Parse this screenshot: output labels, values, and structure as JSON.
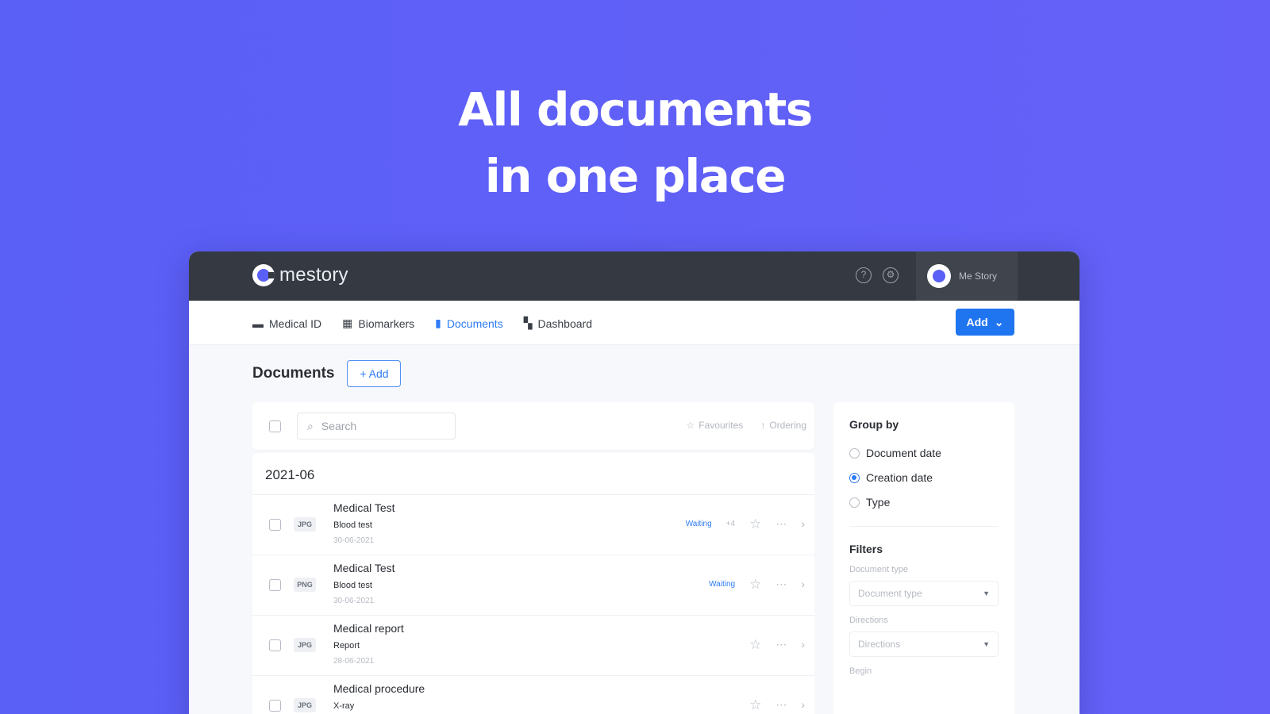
{
  "hero": {
    "line1": "All documents",
    "line2": "in one place"
  },
  "app": {
    "brand": "mestory",
    "profile_name": "Me Story",
    "icons": {
      "help": "question-circle-icon",
      "settings": "gear-icon"
    }
  },
  "nav": {
    "items": [
      {
        "label": "Medical ID",
        "icon": "id-card-icon"
      },
      {
        "label": "Biomarkers",
        "icon": "grid-icon"
      },
      {
        "label": "Documents",
        "icon": "document-icon",
        "active": true
      },
      {
        "label": "Dashboard",
        "icon": "dashboard-icon"
      }
    ],
    "add_label": "Add"
  },
  "documents": {
    "title": "Documents",
    "add_label": "+ Add",
    "search_placeholder": "Search",
    "favourites_label": "Favourites",
    "ordering_label": "Ordering",
    "group": "2021-06",
    "rows": [
      {
        "title": "Medical Test",
        "subtitle": "Blood test",
        "date": "30-06-2021",
        "type": "JPG",
        "status": "Waiting",
        "extra": "+4"
      },
      {
        "title": "Medical Test",
        "subtitle": "Blood test",
        "date": "30-06-2021",
        "type": "PNG",
        "status": "Waiting",
        "extra": ""
      },
      {
        "title": "Medical report",
        "subtitle": "Report",
        "date": "28-06-2021",
        "type": "JPG",
        "status": "",
        "extra": ""
      },
      {
        "title": "Medical procedure",
        "subtitle": "X-ray",
        "date": "",
        "type": "JPG",
        "status": "",
        "extra": ""
      }
    ]
  },
  "sidebar": {
    "group_by_title": "Group by",
    "group_options": [
      {
        "label": "Document date",
        "checked": false
      },
      {
        "label": "Creation date",
        "checked": true
      },
      {
        "label": "Type",
        "checked": false
      }
    ],
    "filters_title": "Filters",
    "doc_type_label": "Document type",
    "doc_type_placeholder": "Document type",
    "directions_label": "Directions",
    "directions_placeholder": "Directions",
    "begin_label": "Begin"
  },
  "colors": {
    "background": "#5a5ff6",
    "accent": "#1f75f0",
    "topbar": "#353a42"
  }
}
